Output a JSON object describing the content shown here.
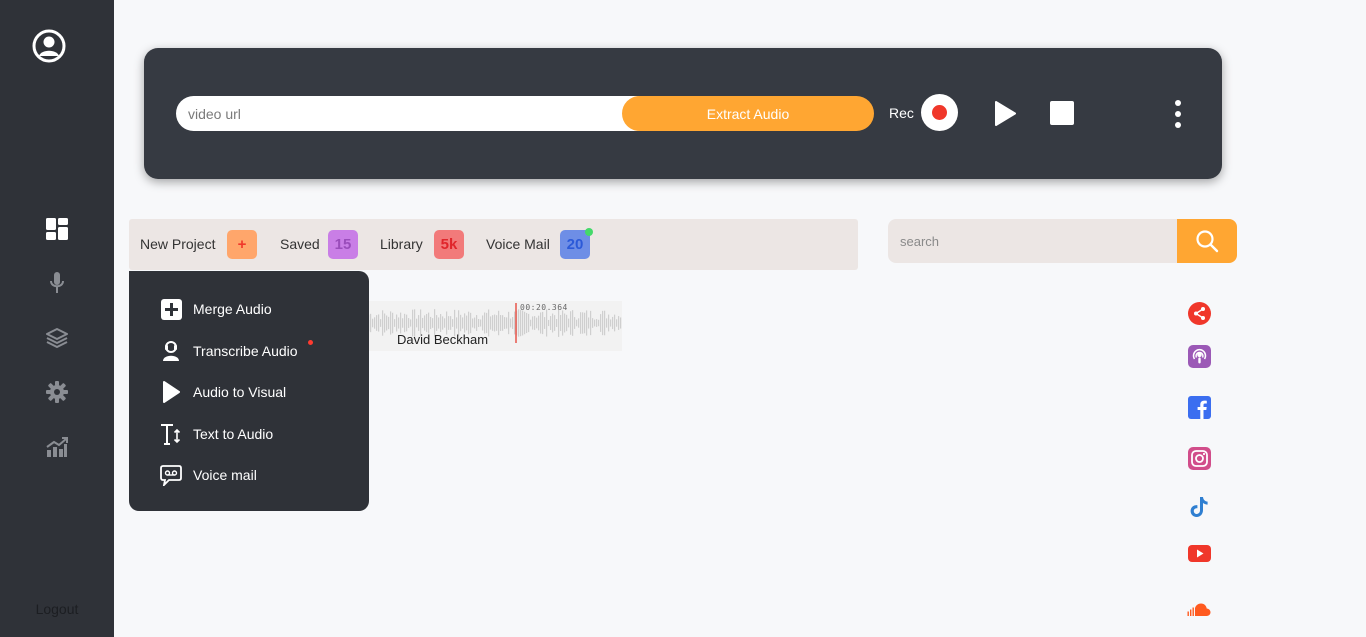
{
  "sidebar": {
    "items": [
      {
        "name": "dashboard",
        "icon": "dashboard-icon"
      },
      {
        "name": "microphone",
        "icon": "microphone-icon"
      },
      {
        "name": "layers",
        "icon": "layers-icon"
      },
      {
        "name": "settings",
        "icon": "gear-icon"
      },
      {
        "name": "analytics",
        "icon": "chart-icon"
      }
    ],
    "logout_label": "Logout"
  },
  "toolbar": {
    "url_placeholder": "video url",
    "extract_label": "Extract Audio",
    "rec_label": "Rec",
    "colors": {
      "accent": "#ffa632",
      "record": "#f0372a",
      "panel": "#363a42"
    }
  },
  "tabs": {
    "new_project": {
      "label": "New Project",
      "badge": "+",
      "badge_color": "#ffa66b"
    },
    "saved": {
      "label": "Saved",
      "badge": "15",
      "badge_color": "#c97ee6"
    },
    "library": {
      "label": "Library",
      "badge": "5k",
      "badge_color": "#f27a7a"
    },
    "voice_mail": {
      "label": "Voice Mail",
      "badge": "20",
      "badge_color": "#6e8ee6"
    }
  },
  "menu": {
    "items": [
      {
        "label": "Merge Audio",
        "icon": "plus-square-icon"
      },
      {
        "label": "Transcribe Audio",
        "icon": "transcriber-icon"
      },
      {
        "label": "Audio to Visual",
        "icon": "play-icon"
      },
      {
        "label": "Text to Audio",
        "icon": "text-size-icon"
      },
      {
        "label": "Voice mail",
        "icon": "voicemail-icon"
      }
    ]
  },
  "track": {
    "name": "David Beckham",
    "timecode": "00:20.364"
  },
  "search": {
    "placeholder": "search"
  },
  "social": [
    {
      "name": "share",
      "icon": "share-icon",
      "color": "#f0372a"
    },
    {
      "name": "podcasts",
      "icon": "podcast-icon",
      "color": "#9b59b6"
    },
    {
      "name": "facebook",
      "icon": "facebook-icon",
      "color": "#3b6ef0"
    },
    {
      "name": "instagram",
      "icon": "instagram-icon",
      "color": "#d14d8a"
    },
    {
      "name": "tiktok",
      "icon": "tiktok-icon",
      "color": "#2f7fd1"
    },
    {
      "name": "youtube",
      "icon": "youtube-icon",
      "color": "#f0372a"
    },
    {
      "name": "soundcloud",
      "icon": "soundcloud-icon",
      "color": "#ff5a1f"
    }
  ]
}
